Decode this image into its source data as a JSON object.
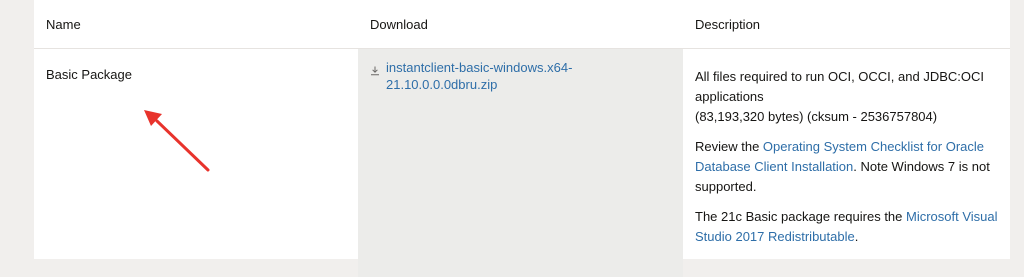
{
  "table": {
    "headers": {
      "name": "Name",
      "download": "Download",
      "description": "Description"
    },
    "row": {
      "name": "Basic Package",
      "download_link": "instantclient-basic-windows.x64-21.10.0.0.0dbru.zip",
      "download_icon": "download-icon",
      "description": {
        "line1": "All files required to run OCI, OCCI, and JDBC:OCI applications",
        "size_checksum": "(83,193,320 bytes) (cksum - 2536757804)",
        "review_prefix": "Review the ",
        "review_link": "Operating System Checklist for Oracle Database Client Installation",
        "review_suffix": ". Note Windows 7 is not supported.",
        "requires_prefix": "The 21c Basic package requires the ",
        "requires_link": "Microsoft Visual Studio 2017 Redistributable",
        "requires_suffix": "."
      }
    }
  },
  "annotation": {
    "arrow_color": "#e8332c"
  },
  "colors": {
    "link": "#2e6ea8",
    "download_column_bg": "#ececea",
    "page_bg": "#f1efed"
  }
}
